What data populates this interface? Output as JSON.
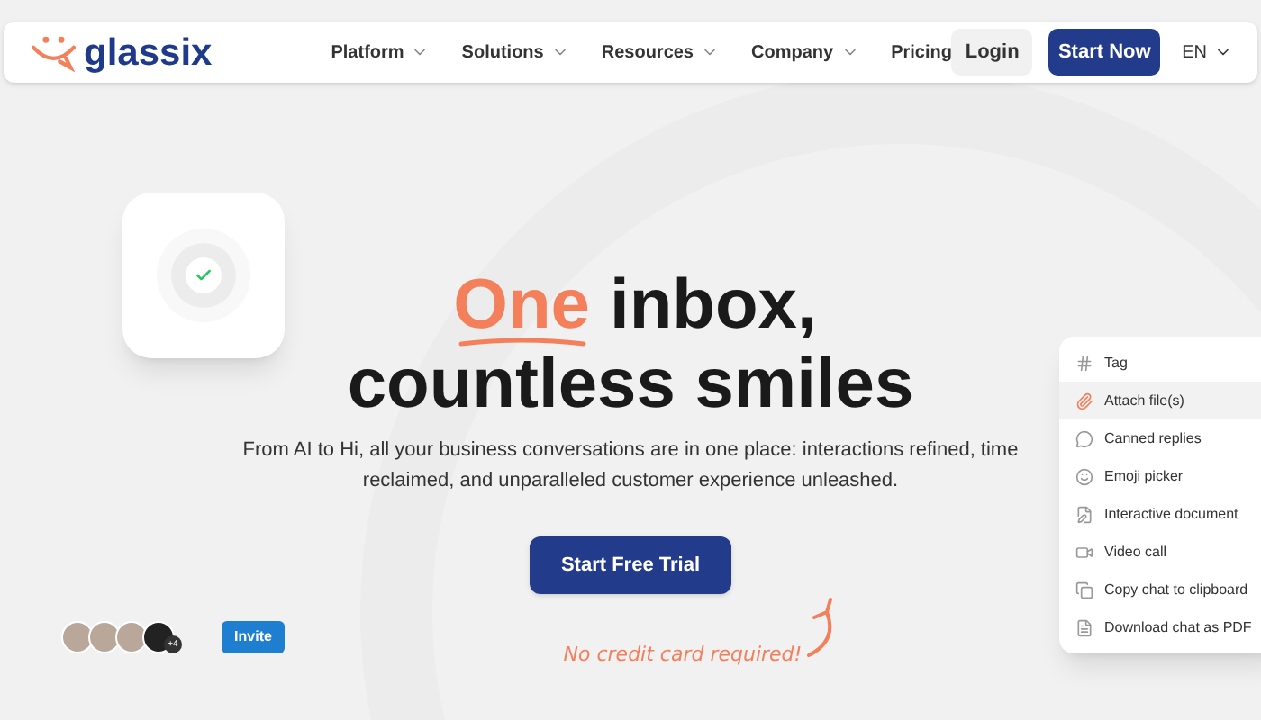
{
  "nav": {
    "logo": "glassix",
    "items": [
      {
        "label": "Platform",
        "has_menu": true
      },
      {
        "label": "Solutions",
        "has_menu": true
      },
      {
        "label": "Resources",
        "has_menu": true
      },
      {
        "label": "Company",
        "has_menu": true
      },
      {
        "label": "Pricing",
        "has_menu": false
      }
    ],
    "login": "Login",
    "start": "Start Now",
    "language": "EN"
  },
  "hero": {
    "highlight": "One",
    "title_rest": "inbox,",
    "title_line2": "countless smiles",
    "description": "From AI to Hi, all your business conversations are in one place: interactions refined, time reclaimed, and unparalleled customer experience unleashed.",
    "cta": "Start Free Trial",
    "note": "No credit card required!"
  },
  "team": {
    "more": "+4",
    "invite": "Invite"
  },
  "menu": [
    {
      "kind": "tag",
      "label": "Tag",
      "selected": false
    },
    {
      "kind": "attach",
      "label": "Attach file(s)",
      "selected": true
    },
    {
      "kind": "canned",
      "label": "Canned replies",
      "selected": false
    },
    {
      "kind": "emoji",
      "label": "Emoji picker",
      "selected": false
    },
    {
      "kind": "document",
      "label": "Interactive document",
      "selected": false
    },
    {
      "kind": "video",
      "label": "Video call",
      "selected": false
    },
    {
      "kind": "copy",
      "label": "Copy chat to clipboard",
      "selected": false
    },
    {
      "kind": "pdf",
      "label": "Download chat as PDF",
      "selected": false
    }
  ]
}
